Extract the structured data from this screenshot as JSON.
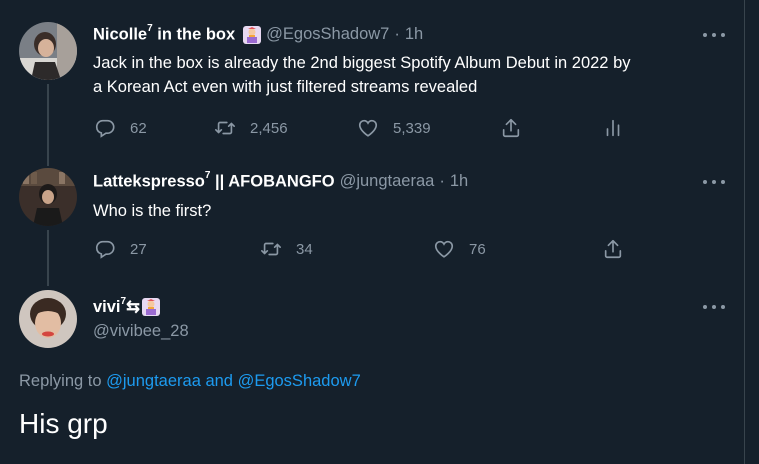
{
  "tweets": [
    {
      "name": "Nicolle",
      "name_sup": "7",
      "name_suffix": " in the box",
      "handle": "@EgosShadow7",
      "separator": "·",
      "time": "1h",
      "text_line1": "Jack in the box is already the 2nd biggest Spotify Album Debut  in 2022 by",
      "text_line2": "a Korean Act even with just filtered streams revealed",
      "replies": "62",
      "retweets": "2,456",
      "likes": "5,339"
    },
    {
      "name": "Lattekspresso",
      "name_sup": "7",
      "name_suffix": " || AFOBANGFO",
      "handle": "@jungtaeraa",
      "separator": "·",
      "time": "1h",
      "text": "Who is the first?",
      "replies": "27",
      "retweets": "34",
      "likes": "76"
    }
  ],
  "main_tweet": {
    "name": "vivi",
    "name_sup": "7",
    "name_symbol": "⇆",
    "handle": "@vivibee_28",
    "replying_prefix": "Replying to ",
    "replying_user1": "@jungtaeraa",
    "replying_and": " and ",
    "replying_user2": "@EgosShadow7",
    "text": "His grp"
  },
  "icons": [
    "reply-icon",
    "retweet-icon",
    "like-icon",
    "share-icon",
    "analytics-icon",
    "more-icon"
  ],
  "colors": {
    "background": "#15202b",
    "text": "#ffffff",
    "muted": "#8b98a5",
    "link": "#1d9bf0",
    "border": "#38444d"
  }
}
